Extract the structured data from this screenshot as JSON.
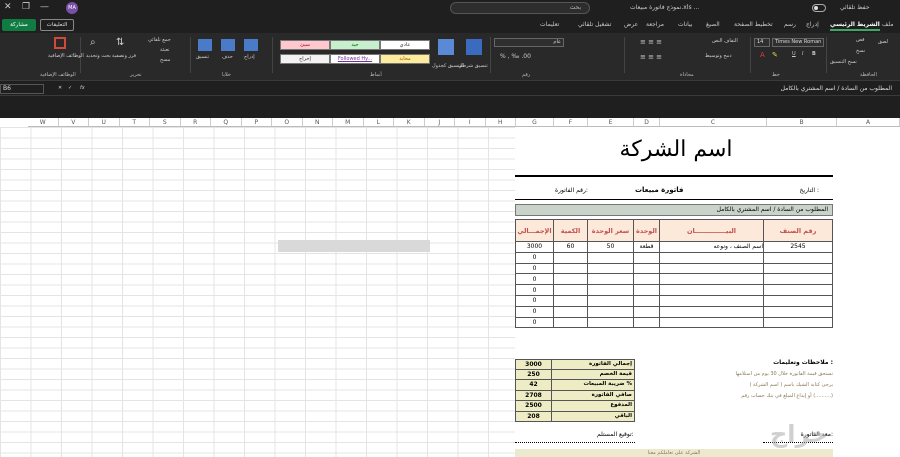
{
  "titlebar": {
    "search_placeholder": "بحث",
    "filename": "نموذج فاتورة مبيعات.xls ...",
    "autosave": "حفظ تلقائي",
    "avatar": "MA"
  },
  "tabs": [
    "ملف",
    "الشريط الرئيسي",
    "إدراج",
    "رسم",
    "تخطيط الصفحة",
    "الصيغ",
    "بيانات",
    "مراجعة",
    "عرض",
    "تشغيل تلقائي",
    "تعليمات"
  ],
  "toolbar": {
    "share_label": "مشاركة",
    "comments_label": "التعليقات"
  },
  "ribbon": {
    "groups": [
      "الحافظة",
      "خط",
      "محاذاة",
      "رقم",
      "أنماط",
      "خلايا",
      "تحرير",
      "الوظائف الإضافية"
    ],
    "clipboard": {
      "paste": "لصق",
      "cut": "قص",
      "copy": "نسخ",
      "format_painter": "نسخ التنسيق"
    },
    "font": {
      "name": "Times New Roman",
      "size": "14",
      "bold": "B",
      "italic": "I",
      "underline": "U"
    },
    "alignment": {
      "wrap": "التفاف النص",
      "merge": "دمج وتوسيط"
    },
    "number": {
      "format": "عام"
    },
    "styles": {
      "conditional": "تنسيق شرطي",
      "as_table": "التنسيق كجدول",
      "normal": "عادي",
      "good": "جيد",
      "bad": "سيئ",
      "neutral": "محايد",
      "followed": "Followed Hy...",
      "output": "إخراج"
    },
    "cells": {
      "insert": "إدراج",
      "delete": "حذف",
      "format": "تنسيق"
    },
    "editing": {
      "autosum": "جمع تلقائي",
      "fill": "تعبئة",
      "clear": "مسح",
      "sort": "فرز وتصفية",
      "find": "بحث وتحديد"
    },
    "addins": {
      "label": "الوظائف الإضافية"
    }
  },
  "formula_bar": {
    "cell_ref": "B6",
    "fx": "fx",
    "content": "المطلوب من السادة / اسم المشتري بالكامل"
  },
  "columns": [
    "A",
    "B",
    "C",
    "D",
    "E",
    "F",
    "G",
    "H",
    "I",
    "J",
    "K",
    "L",
    "M",
    "N",
    "O",
    "P",
    "Q",
    "R",
    "S",
    "T",
    "U",
    "V",
    "W"
  ],
  "invoice": {
    "company_name": "اسم الشركة",
    "date_label": "التاريخ :",
    "title": "فاتورة مبيعات",
    "invoice_no_label": "رقم الفاتورة:",
    "customer_line": "المطلوب من السادة / اسم المشتري بالكامل",
    "headers": [
      "رقم الصنف",
      "البيــــــــــــــان",
      "الوحدة",
      "سعر الوحدة",
      "الكمية",
      "الإجمـــالي"
    ],
    "rows": [
      [
        "2545",
        "اسم الصنف ، ونوعه",
        "قطعة",
        "50",
        "60",
        "3000"
      ],
      [
        "",
        "",
        "",
        "",
        "",
        "0"
      ],
      [
        "",
        "",
        "",
        "",
        "",
        "0"
      ],
      [
        "",
        "",
        "",
        "",
        "",
        "0"
      ],
      [
        "",
        "",
        "",
        "",
        "",
        "0"
      ],
      [
        "",
        "",
        "",
        "",
        "",
        "0"
      ],
      [
        "",
        "",
        "",
        "",
        "",
        "0"
      ],
      [
        "",
        "",
        "",
        "",
        "",
        "0"
      ]
    ],
    "totals": [
      {
        "label": "إجمالي الفاتورة",
        "value": "3000"
      },
      {
        "label": "قيمة الخصم",
        "value": "250"
      },
      {
        "label": "ضريبة المبيعات %",
        "value": "42"
      },
      {
        "label": "صافي الفاتورة",
        "value": "2708"
      },
      {
        "label": "المدفوع",
        "value": "2500"
      },
      {
        "label": "الباقي",
        "value": "208"
      }
    ],
    "notes_label": "ملاحظات وتعليمات :",
    "notes": [
      "تستحق قيمة الفاتورة خلال 30 يوم من استلامها",
      "يرجى كتابة الشيك باسم ( اسم الشركة )",
      "أو إيداع المبلغ في بنك حساب رقم (..........)"
    ],
    "issuer_label": "معد الفاتورة:",
    "receiver_label": "توقيع المستلم:",
    "footer": "الشركة على تعاملكم معنا"
  },
  "watermark": "حراج"
}
